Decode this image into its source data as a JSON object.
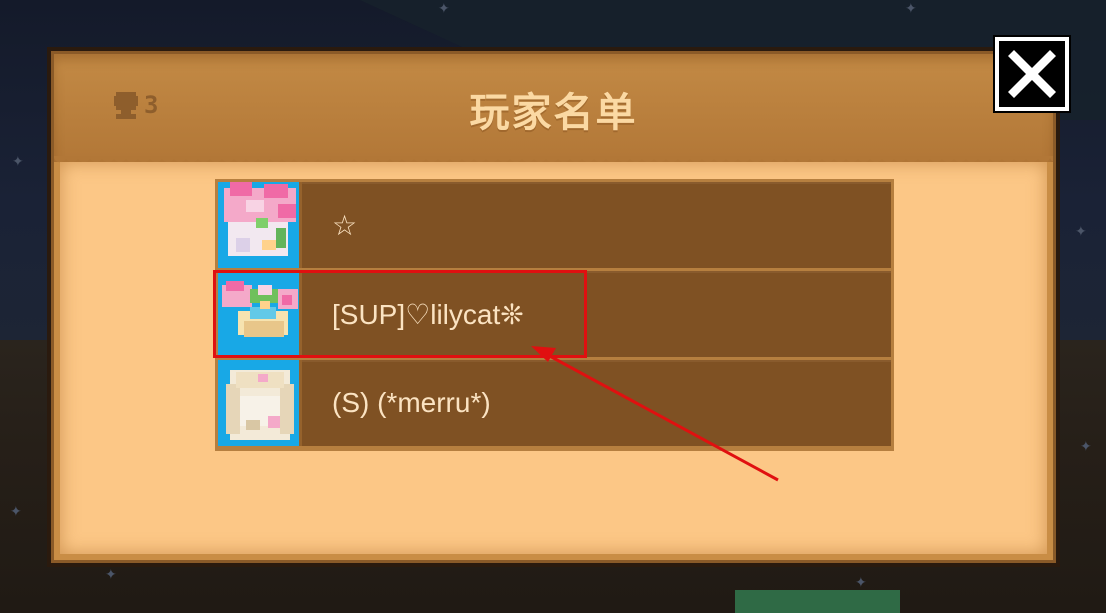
{
  "dialog": {
    "title": "玩家名单",
    "player_count": "3",
    "close_label": "close"
  },
  "players": [
    {
      "name": "☆",
      "avatar": "pink-flower-hat-avatar"
    },
    {
      "name": "[SUP]♡lilycat❊",
      "avatar": "flower-crown-avatar"
    },
    {
      "name": "(S) (*merru*)",
      "avatar": "blonde-hair-avatar"
    }
  ],
  "annotation": {
    "highlight_color": "#e01010",
    "target": "player-row-lilycat"
  },
  "colors": {
    "panel": "#c98d45",
    "panel_body": "#fcc786",
    "row": "#7f5123",
    "avatar_bg": "#18a8e6",
    "title": "#fbd9a3"
  }
}
